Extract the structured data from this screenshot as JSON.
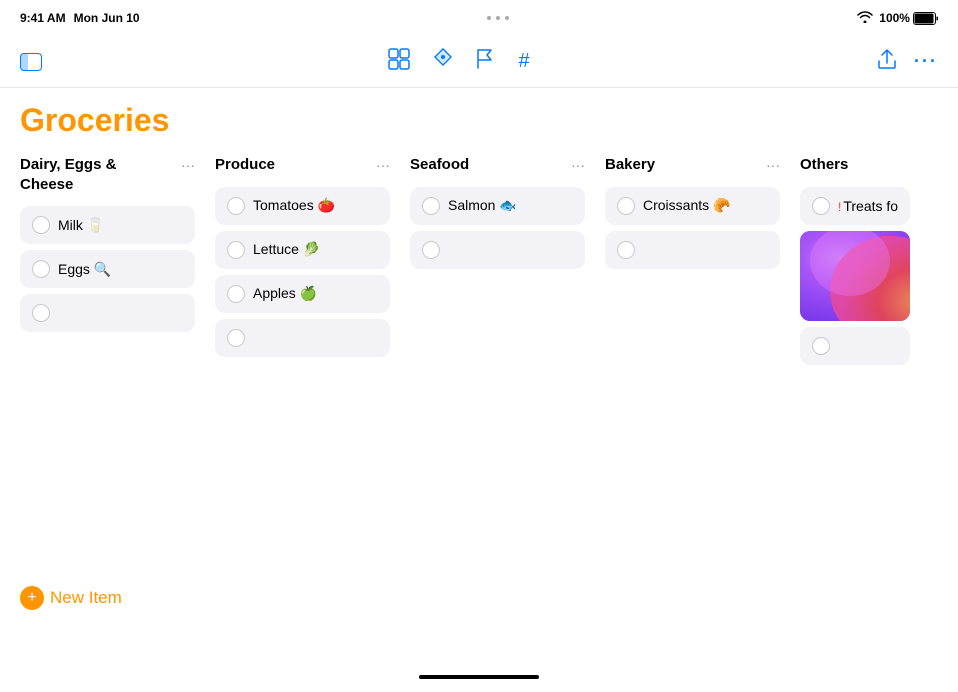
{
  "status_bar": {
    "time": "9:41 AM",
    "date": "Mon Jun 10",
    "wifi": "📶",
    "battery_percent": "100%",
    "dots": [
      "•",
      "•",
      "•"
    ]
  },
  "toolbar": {
    "sidebar_toggle_label": "⊟",
    "center_icons": [
      {
        "name": "grid-icon",
        "symbol": "⊞"
      },
      {
        "name": "location-icon",
        "symbol": "➤"
      },
      {
        "name": "flag-icon",
        "symbol": "⚑"
      },
      {
        "name": "hashtag-icon",
        "symbol": "#"
      }
    ],
    "right_icons": [
      {
        "name": "share-icon",
        "symbol": "⎙"
      },
      {
        "name": "more-icon",
        "symbol": "···"
      }
    ]
  },
  "page": {
    "title": "Groceries"
  },
  "columns": [
    {
      "id": "dairy",
      "title": "Dairy, Eggs & Cheese",
      "items": [
        {
          "text": "Milk 🥛",
          "checked": false
        },
        {
          "text": "Eggs 🔍",
          "checked": false
        }
      ],
      "has_empty": true
    },
    {
      "id": "produce",
      "title": "Produce",
      "items": [
        {
          "text": "Tomatoes 🍅",
          "checked": false
        },
        {
          "text": "Lettuce 🥬",
          "checked": false
        },
        {
          "text": "Apples 🍏",
          "checked": false
        }
      ],
      "has_empty": true
    },
    {
      "id": "seafood",
      "title": "Seafood",
      "items": [
        {
          "text": "Salmon 🐟",
          "checked": false
        }
      ],
      "has_empty": true
    },
    {
      "id": "bakery",
      "title": "Bakery",
      "items": [
        {
          "text": "Croissants 🥐",
          "checked": false
        }
      ],
      "has_empty": true
    },
    {
      "id": "others",
      "title": "Others",
      "items": [
        {
          "text": "Treats for",
          "checked": false,
          "has_flag": true
        }
      ],
      "has_image": true,
      "has_empty": true
    }
  ],
  "new_item": {
    "label": "New Item",
    "plus": "+"
  },
  "bottom": {
    "home_indicator": true
  }
}
